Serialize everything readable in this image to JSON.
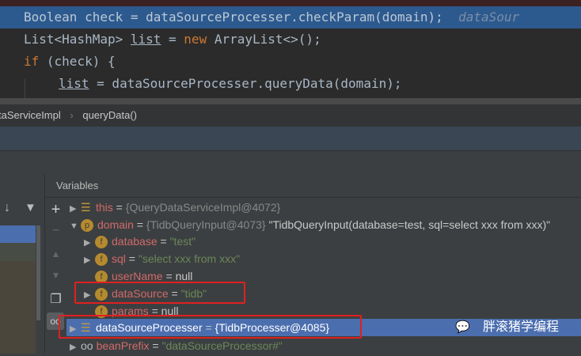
{
  "editor": {
    "lines": [
      {
        "text": "Boolean check = dataSourceProcesser.checkParam(domain);",
        "hint": "dataSour"
      },
      {
        "a": "List<HashMap> ",
        "u": "list",
        "b": " = ",
        "kw": "new",
        "c": " ArrayList<>();"
      },
      {
        "kw": "if",
        "c": " (check) {"
      },
      {
        "u": "list",
        "c": " = dataSourceProcesser.queryData(domain);"
      }
    ]
  },
  "breadcrumb": {
    "items": [
      "taServiceImpl",
      "queryData()"
    ],
    "sep": "›"
  },
  "variables": {
    "title": "Variables",
    "rows": [
      {
        "name": "this",
        "eq": " = ",
        "value": "{QueryDataServiceImpl@4072}",
        "badge": "bars"
      },
      {
        "name": "domain",
        "eq": " = ",
        "value": "{TidbQueryInput@4073}",
        "extra": " \"TidbQueryInput(database=test, sql=select xxx from xxx)\"",
        "badge": "p"
      },
      {
        "name": "database",
        "eq": " = ",
        "value": "\"test\"",
        "badge": "f"
      },
      {
        "name": "sql",
        "eq": " = ",
        "value": "\"select xxx from xxx\"",
        "badge": "f"
      },
      {
        "name": "userName",
        "eq": " = ",
        "value": "null",
        "badge": "f"
      },
      {
        "name": "dataSource",
        "eq": " = ",
        "value": "\"tidb\"",
        "badge": "f"
      },
      {
        "name": "params",
        "eq": " = ",
        "value": "null",
        "badge": "f"
      },
      {
        "name": "dataSourceProcesser",
        "eq": " = ",
        "value": "{TidbProcesser@4085}",
        "badge": "bars"
      },
      {
        "name": "beanPrefix",
        "eq": " = ",
        "value": "\"dataSourceProcessor#\"",
        "badge": "oo"
      }
    ]
  },
  "watermark": "胖滚猪学编程",
  "colors": {
    "highlight": "#2d5a8e",
    "selection": "#4b6eaf",
    "annotation": "#e02020"
  }
}
